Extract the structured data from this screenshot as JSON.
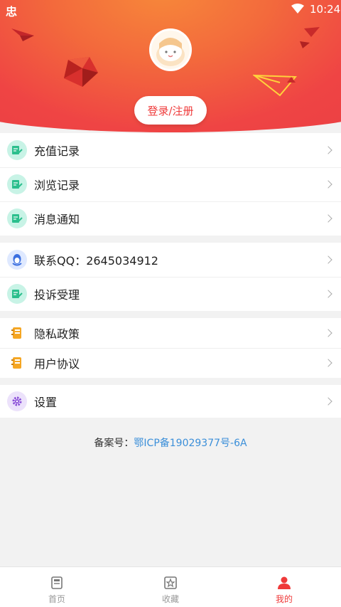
{
  "status": {
    "time": "10:24",
    "app_icon": "忠"
  },
  "header": {
    "login_label": "登录/注册"
  },
  "groups": [
    {
      "items": [
        {
          "label": "充值记录",
          "icon": "edit-note-icon"
        },
        {
          "label": "浏览记录",
          "icon": "edit-note-icon"
        },
        {
          "label": "消息通知",
          "icon": "edit-note-icon"
        }
      ]
    },
    {
      "items": [
        {
          "label": "联系QQ：2645034912",
          "icon": "qq-penguin-icon"
        },
        {
          "label": "投诉受理",
          "icon": "edit-note-icon"
        }
      ]
    },
    {
      "items": [
        {
          "label": "隐私政策",
          "icon": "notebook-icon"
        },
        {
          "label": "用户协议",
          "icon": "notebook-icon"
        }
      ]
    },
    {
      "items": [
        {
          "label": "设置",
          "icon": "gear-icon"
        }
      ]
    }
  ],
  "footer": {
    "beian_label": "备案号：",
    "beian_value": "鄂ICP备19029377号-6A"
  },
  "bottom_nav": [
    {
      "label": "首页",
      "icon": "book-icon"
    },
    {
      "label": "收藏",
      "icon": "star-box-icon"
    },
    {
      "label": "我的",
      "icon": "person-icon"
    }
  ],
  "colors": {
    "accent": "#ef3a3a",
    "mint": "#c8f3e6",
    "link": "#3b8fd9"
  }
}
